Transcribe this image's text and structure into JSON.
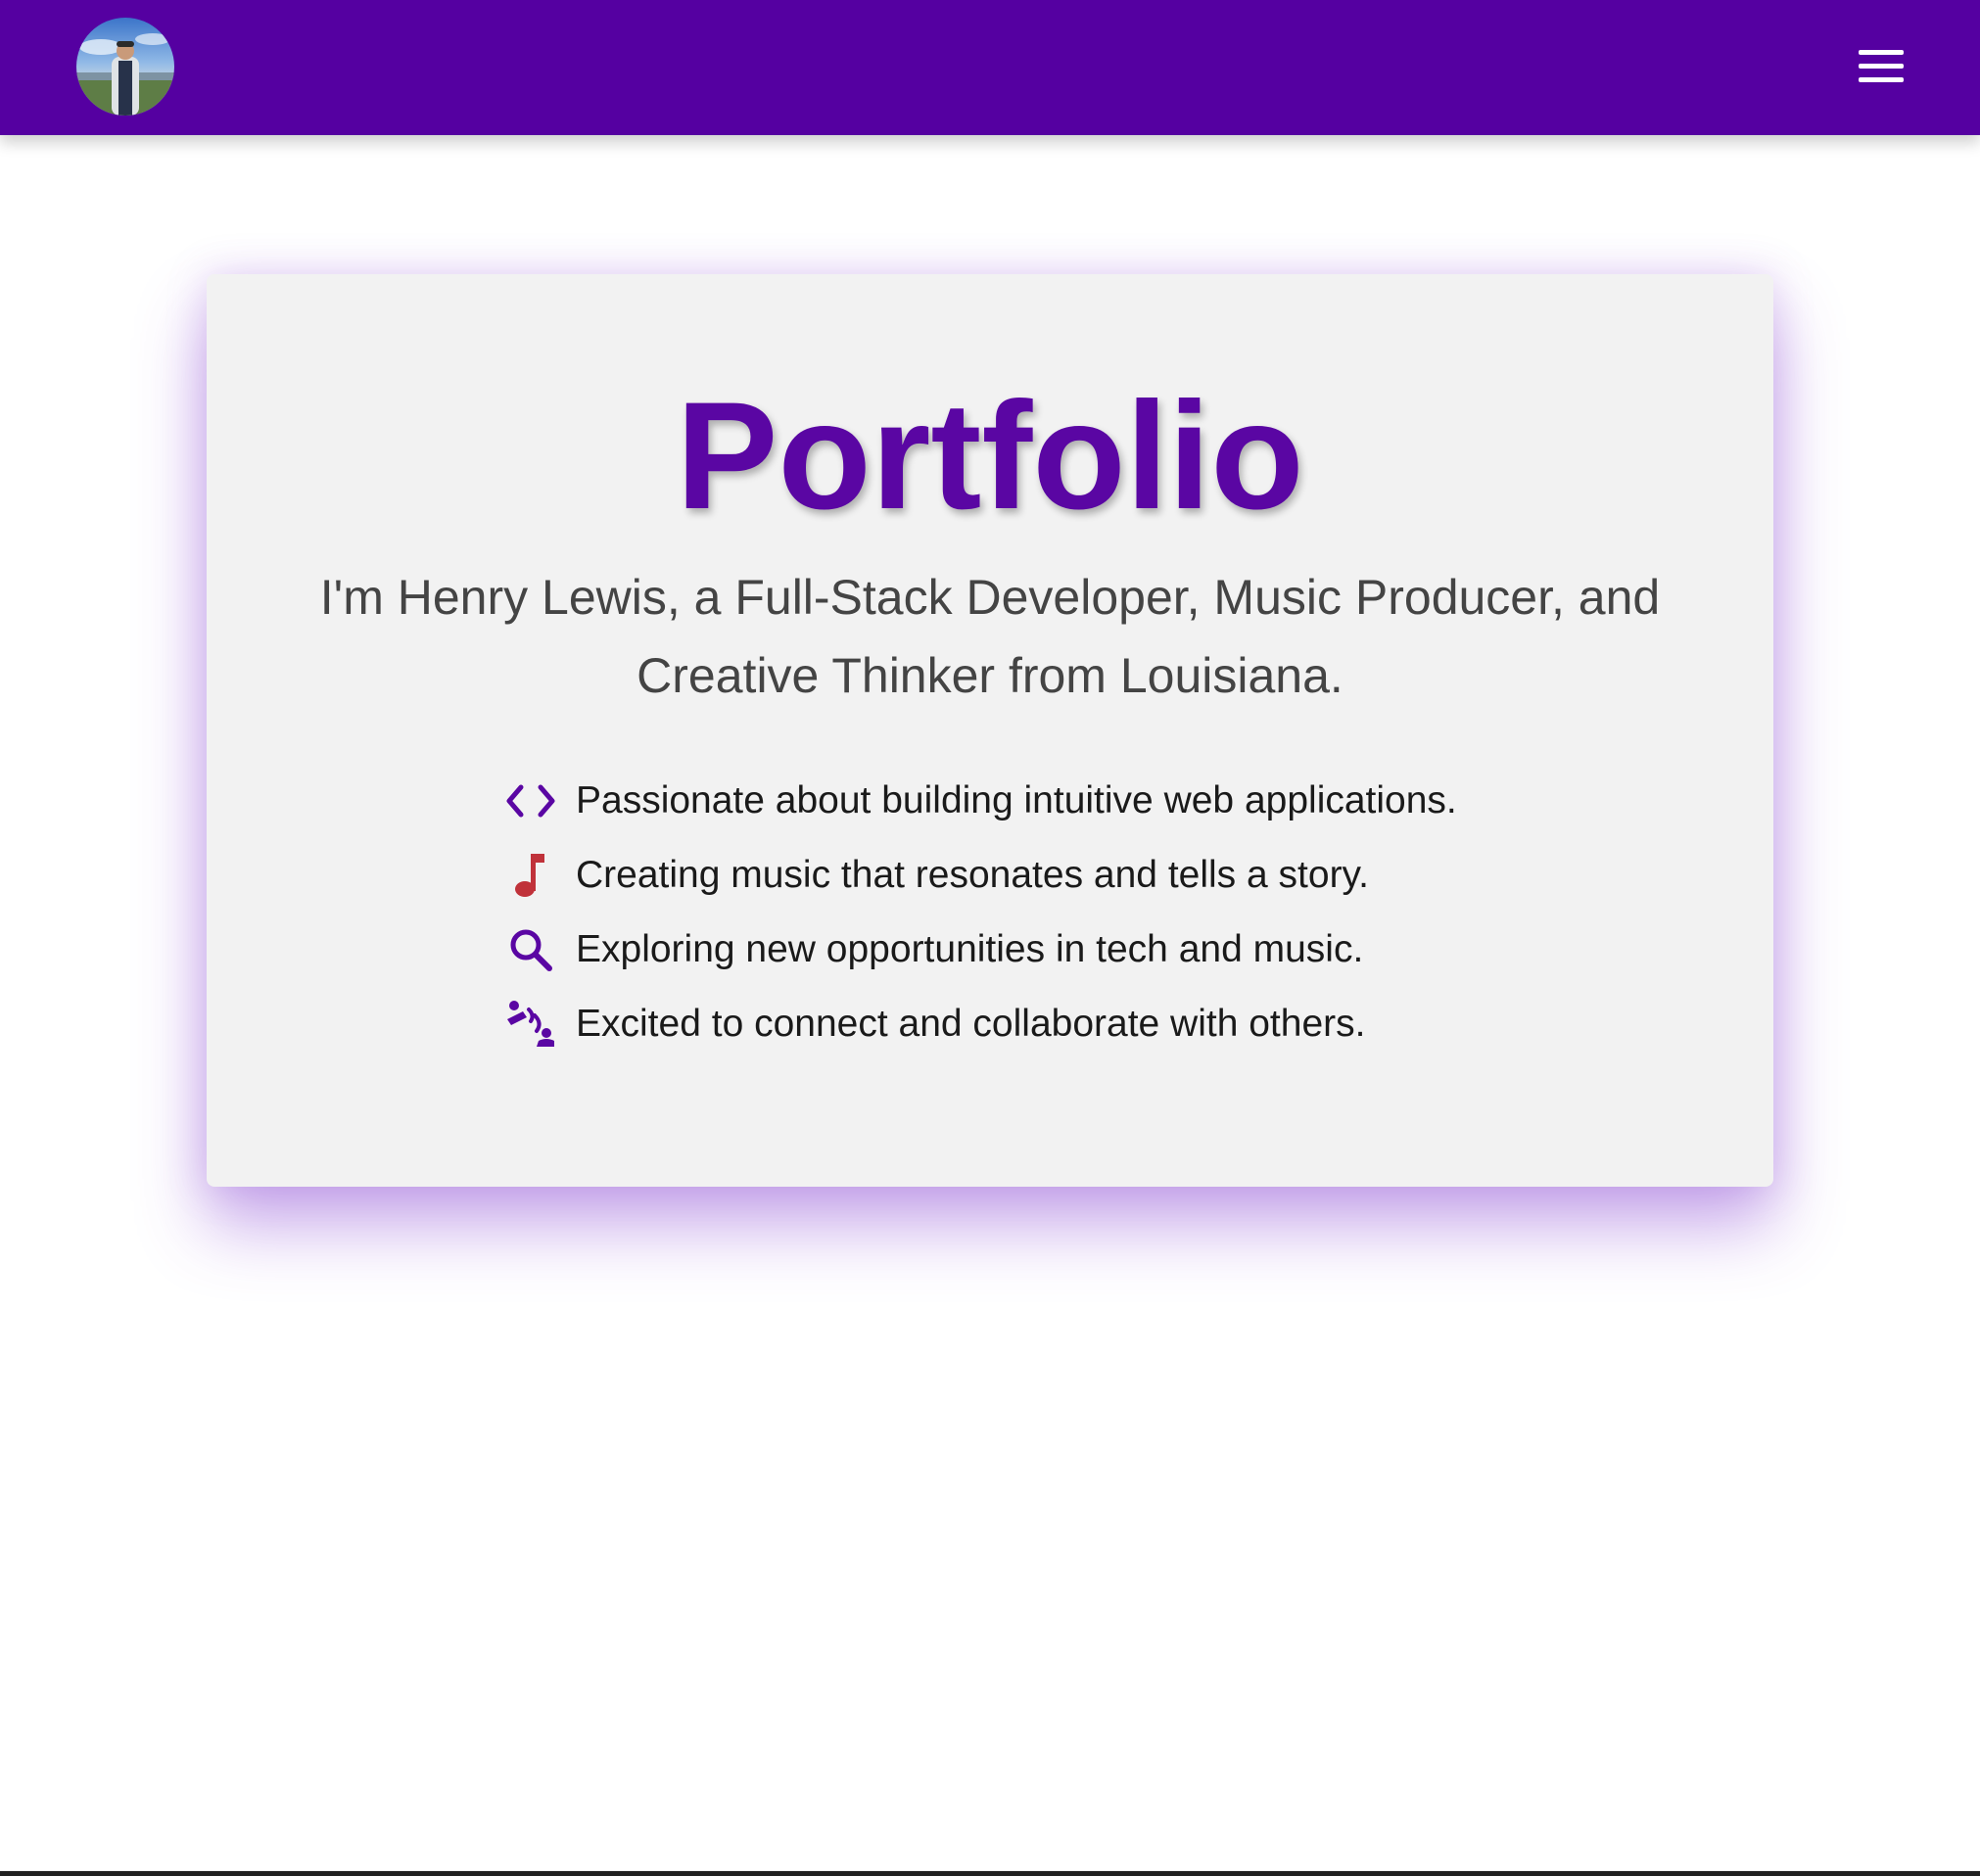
{
  "navbar": {
    "background_color": "#5500a1",
    "avatar_alt": "profile photo",
    "menu_icon": "hamburger-menu-icon"
  },
  "hero": {
    "title": "Portfolio",
    "title_color": "#5a06a3",
    "intro": "I'm Henry Lewis, a Full-Stack Developer, Music Producer, and Creative Thinker from Louisiana.",
    "points": [
      {
        "icon": "code-icon",
        "text": "Passionate about building intuitive web applications."
      },
      {
        "icon": "music-note-icon",
        "text": "Creating music that resonates and tells a story."
      },
      {
        "icon": "search-icon",
        "text": "Exploring new opportunities in tech and music."
      },
      {
        "icon": "people-collaborate-icon",
        "text": "Excited to connect and collaborate with others."
      }
    ]
  }
}
